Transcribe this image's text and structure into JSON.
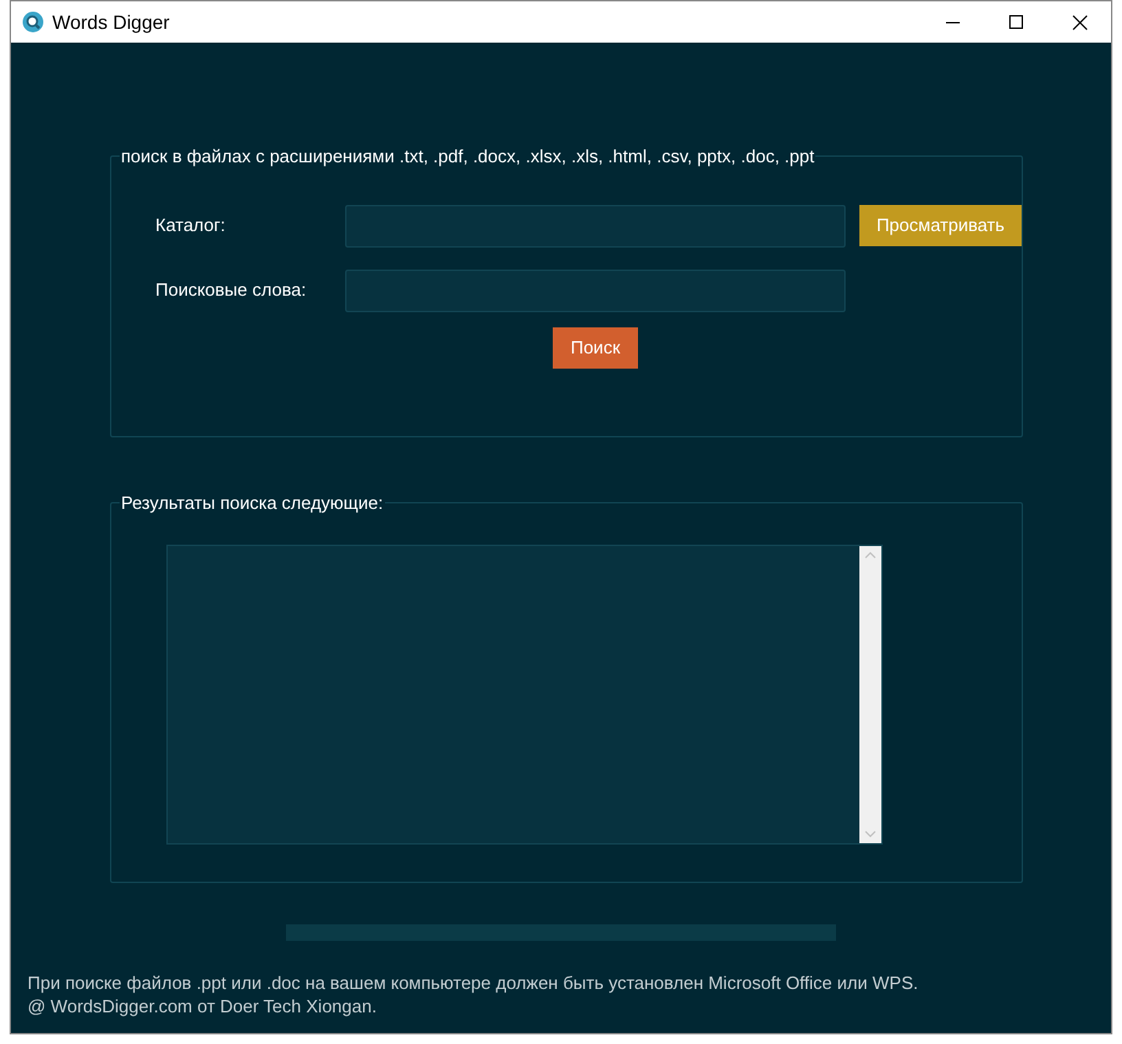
{
  "window": {
    "title": "Words Digger"
  },
  "search_group": {
    "legend": "поиск в файлах с расширениями .txt, .pdf, .docx, .xlsx, .xls, .html, .csv, pptx, .doc, .ppt",
    "fields": [
      {
        "label": "Каталог:",
        "button": "Просматривать"
      },
      {
        "label": "Поисковые слова:"
      }
    ],
    "search_button": "Поиск"
  },
  "results_group": {
    "legend": "Результаты поиска следующие:"
  },
  "progress": {
    "level": 0
  },
  "footer": [
    "При поиске файлов .ppt или .doc на вашем компьютере должен быть установлен Microsoft Office или WPS.",
    "@ WordsDigger.com от Doer Tech Xiongan."
  ]
}
